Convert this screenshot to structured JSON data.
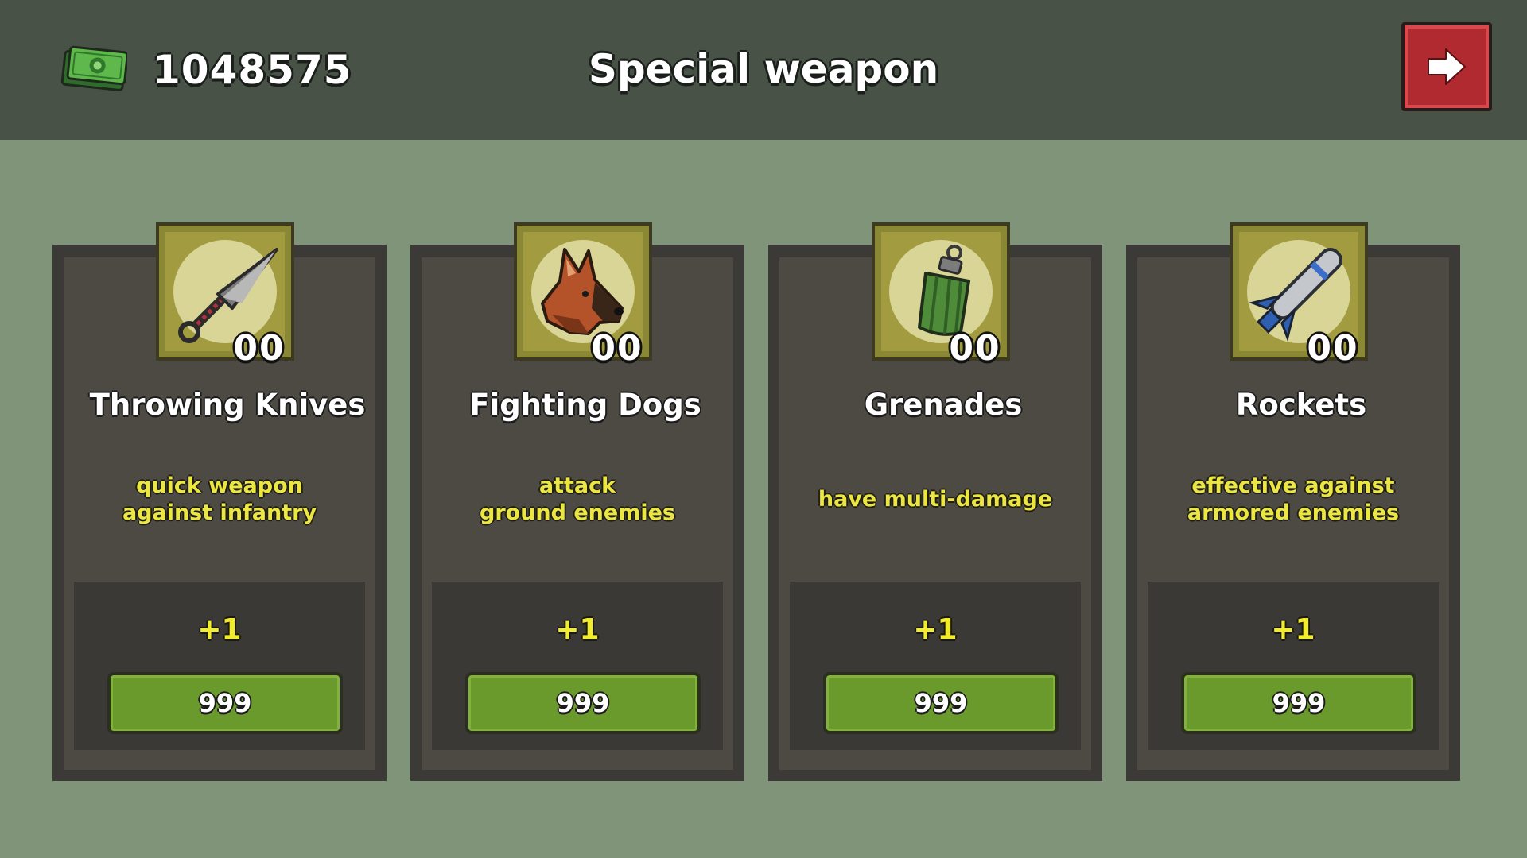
{
  "header": {
    "currency_icon": "cash-stack-icon",
    "money": "1048575",
    "title": "Special weapon",
    "next_icon": "arrow-right-icon"
  },
  "colors": {
    "background": "#7f9478",
    "topbar": "#485247",
    "next_button": "#b02a30",
    "buy_button": "#6a9a2c",
    "description_text": "#ece642",
    "bonus_text": "#f2ec2c"
  },
  "weapons": [
    {
      "name": "Throwing Knives",
      "icon": "kunai-knife-icon",
      "count": "00",
      "description": "quick weapon\nagainst infantry",
      "bonus": "+1",
      "price": "999"
    },
    {
      "name": "Fighting Dogs",
      "icon": "dog-head-icon",
      "count": "00",
      "description": "attack\nground enemies",
      "bonus": "+1",
      "price": "999"
    },
    {
      "name": "Grenades",
      "icon": "grenade-icon",
      "count": "00",
      "description": "have multi-damage",
      "bonus": "+1",
      "price": "999"
    },
    {
      "name": "Rockets",
      "icon": "rocket-icon",
      "count": "00",
      "description": "effective against\narmored enemies",
      "bonus": "+1",
      "price": "999"
    }
  ]
}
